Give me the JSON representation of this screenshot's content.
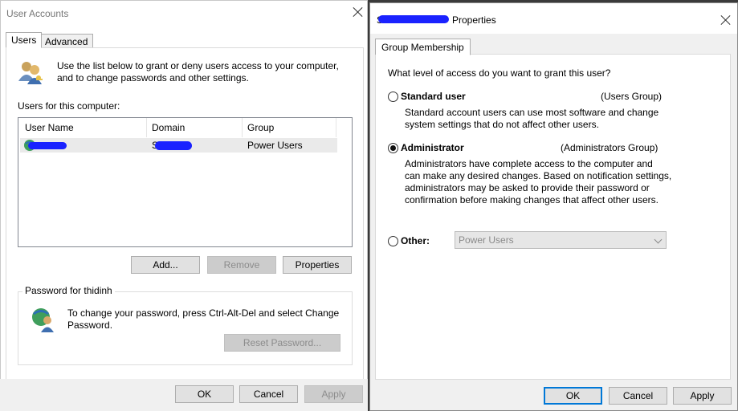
{
  "left_window": {
    "title": "User Accounts",
    "tabs": [
      {
        "label": "Users"
      },
      {
        "label": "Advanced"
      }
    ],
    "intro_line1": "Use the list below to grant or deny users access to your computer,",
    "intro_line2": "and to change passwords and other settings.",
    "users_label": "Users for this computer:",
    "columns": [
      "User Name",
      "Domain",
      "Group"
    ],
    "rows": [
      {
        "user_name": "",
        "domain": "S",
        "group": "Power Users"
      }
    ],
    "add_button": "Add...",
    "remove_button": "Remove",
    "properties_button": "Properties",
    "password_group_label": "Password for thidinh",
    "password_line1": "To change your password, press Ctrl-Alt-Del and select Change",
    "password_line2": "Password.",
    "reset_password_button": "Reset Password...",
    "ok_button": "OK",
    "cancel_button": "Cancel",
    "apply_button": "Apply"
  },
  "right_window": {
    "title_prefix": "S",
    "title_suffix": "Properties",
    "tab": "Group Membership",
    "question": "What level of access do you want to grant this user?",
    "standard": {
      "label": "Standard user",
      "group": "(Users Group)",
      "desc_line1": "Standard account users can use most software and change",
      "desc_line2": "system settings that do not affect other users."
    },
    "administrator": {
      "label": "Administrator",
      "group": "(Administrators Group)",
      "desc_line1": "Administrators have complete access to the computer and",
      "desc_line2": "can make any desired changes. Based on notification settings,",
      "desc_line3": "administrators may be asked to provide their password or",
      "desc_line4": "confirmation before making changes that affect other users."
    },
    "other": {
      "label": "Other:",
      "selected": "Power Users"
    },
    "selected_option": "administrator",
    "ok_button": "OK",
    "cancel_button": "Cancel",
    "apply_button": "Apply"
  },
  "colors": {
    "accent": "#0078d7",
    "redaction": "#1a22ff"
  }
}
